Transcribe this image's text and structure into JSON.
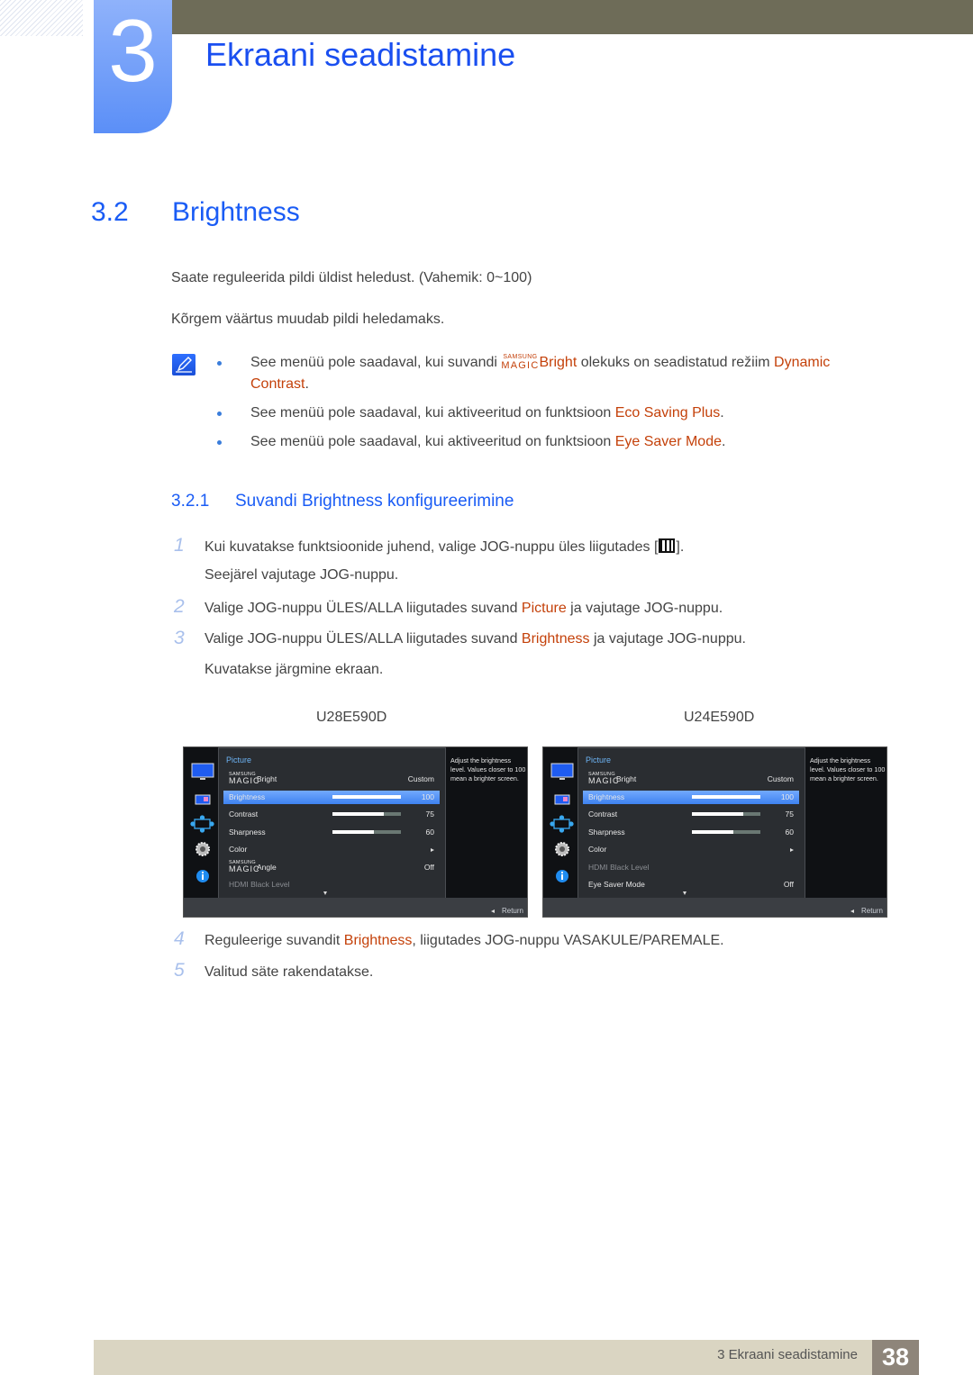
{
  "header": {
    "chapter_number": "3",
    "chapter_title": "Ekraani seadistamine"
  },
  "section": {
    "number": "3.2",
    "title": "Brightness",
    "paragraphs": [
      "Saate reguleerida pildi üldist heledust. (Vahemik: 0~100)",
      "Kõrgem väärtus muudab pildi heledamaks."
    ]
  },
  "notes": [
    {
      "prefix": "See menüü pole saadaval, kui suvandi ",
      "magic_small": "SAMSUNG",
      "magic_big": "MAGIC",
      "highlight1": "Bright",
      "middle": " olekuks on seadistatud režiim ",
      "highlight2": "Dynamic",
      "line2_highlight": "Contrast",
      "suffix": "."
    },
    {
      "prefix": "See menüü pole saadaval, kui aktiveeritud on funktsioon ",
      "highlight": "Eco Saving Plus",
      "suffix": "."
    },
    {
      "prefix": "See menüü pole saadaval, kui aktiveeritud on funktsioon ",
      "highlight": "Eye Saver Mode",
      "suffix": "."
    }
  ],
  "subsection": {
    "number": "3.2.1",
    "title": "Suvandi Brightness konfigureerimine"
  },
  "steps": [
    {
      "num": "1",
      "text_a": "Kui kuvatakse funktsioonide juhend, valige JOG-nuppu üles liigutades [",
      "text_b": "].",
      "line2": "Seejärel vajutage JOG-nuppu."
    },
    {
      "num": "2",
      "text_a": "Valige JOG-nuppu ÜLES/ALLA liigutades suvand ",
      "highlight": "Picture",
      "text_b": " ja vajutage JOG-nuppu."
    },
    {
      "num": "3",
      "text_a": "Valige JOG-nuppu ÜLES/ALLA liigutades suvand ",
      "highlight": "Brightness",
      "text_b": " ja vajutage JOG-nuppu.",
      "line2": "Kuvatakse järgmine ekraan."
    },
    {
      "num": "4",
      "text_a": "Reguleerige suvandit ",
      "highlight": "Brightness",
      "text_b": ", liigutades JOG-nuppu VASAKULE/PAREMALE."
    },
    {
      "num": "5",
      "text_a": "Valitud säte rakendatakse."
    }
  ],
  "osd_screens": [
    {
      "model": "U28E590D",
      "menu_title": "Picture",
      "help_text": "Adjust the brightness level. Values closer to 100 mean a brighter screen.",
      "return_label": "Return",
      "items": [
        {
          "label": "Bright",
          "magic": true,
          "value": "Custom"
        },
        {
          "label": "Brightness",
          "value": "100",
          "level": 100,
          "selected": true
        },
        {
          "label": "Contrast",
          "value": "75",
          "level": 75
        },
        {
          "label": "Sharpness",
          "value": "60",
          "level": 60
        },
        {
          "label": "Color",
          "arrow": true
        },
        {
          "label": "Angle",
          "magic": true,
          "value": "Off"
        },
        {
          "label": "HDMI Black Level",
          "disabled": true
        }
      ]
    },
    {
      "model": "U24E590D",
      "menu_title": "Picture",
      "help_text": "Adjust the brightness level. Values closer to 100 mean a brighter screen.",
      "return_label": "Return",
      "items": [
        {
          "label": "Bright",
          "magic": true,
          "value": "Custom"
        },
        {
          "label": "Brightness",
          "value": "100",
          "level": 100,
          "selected": true
        },
        {
          "label": "Contrast",
          "value": "75",
          "level": 75
        },
        {
          "label": "Sharpness",
          "value": "60",
          "level": 60
        },
        {
          "label": "Color",
          "arrow": true
        },
        {
          "label": "HDMI Black Level",
          "disabled": true
        },
        {
          "label": "Eye Saver Mode",
          "value": "Off"
        }
      ]
    }
  ],
  "magic_brand": {
    "small": "SAMSUNG",
    "big": "MAGIC"
  },
  "footer": {
    "label": "3 Ekraani seadistamine",
    "page": "38"
  },
  "colors": {
    "heading_blue": "#1a5cf5",
    "highlight_orange": "#c4410a",
    "osd_selected": "#3e82f0"
  }
}
